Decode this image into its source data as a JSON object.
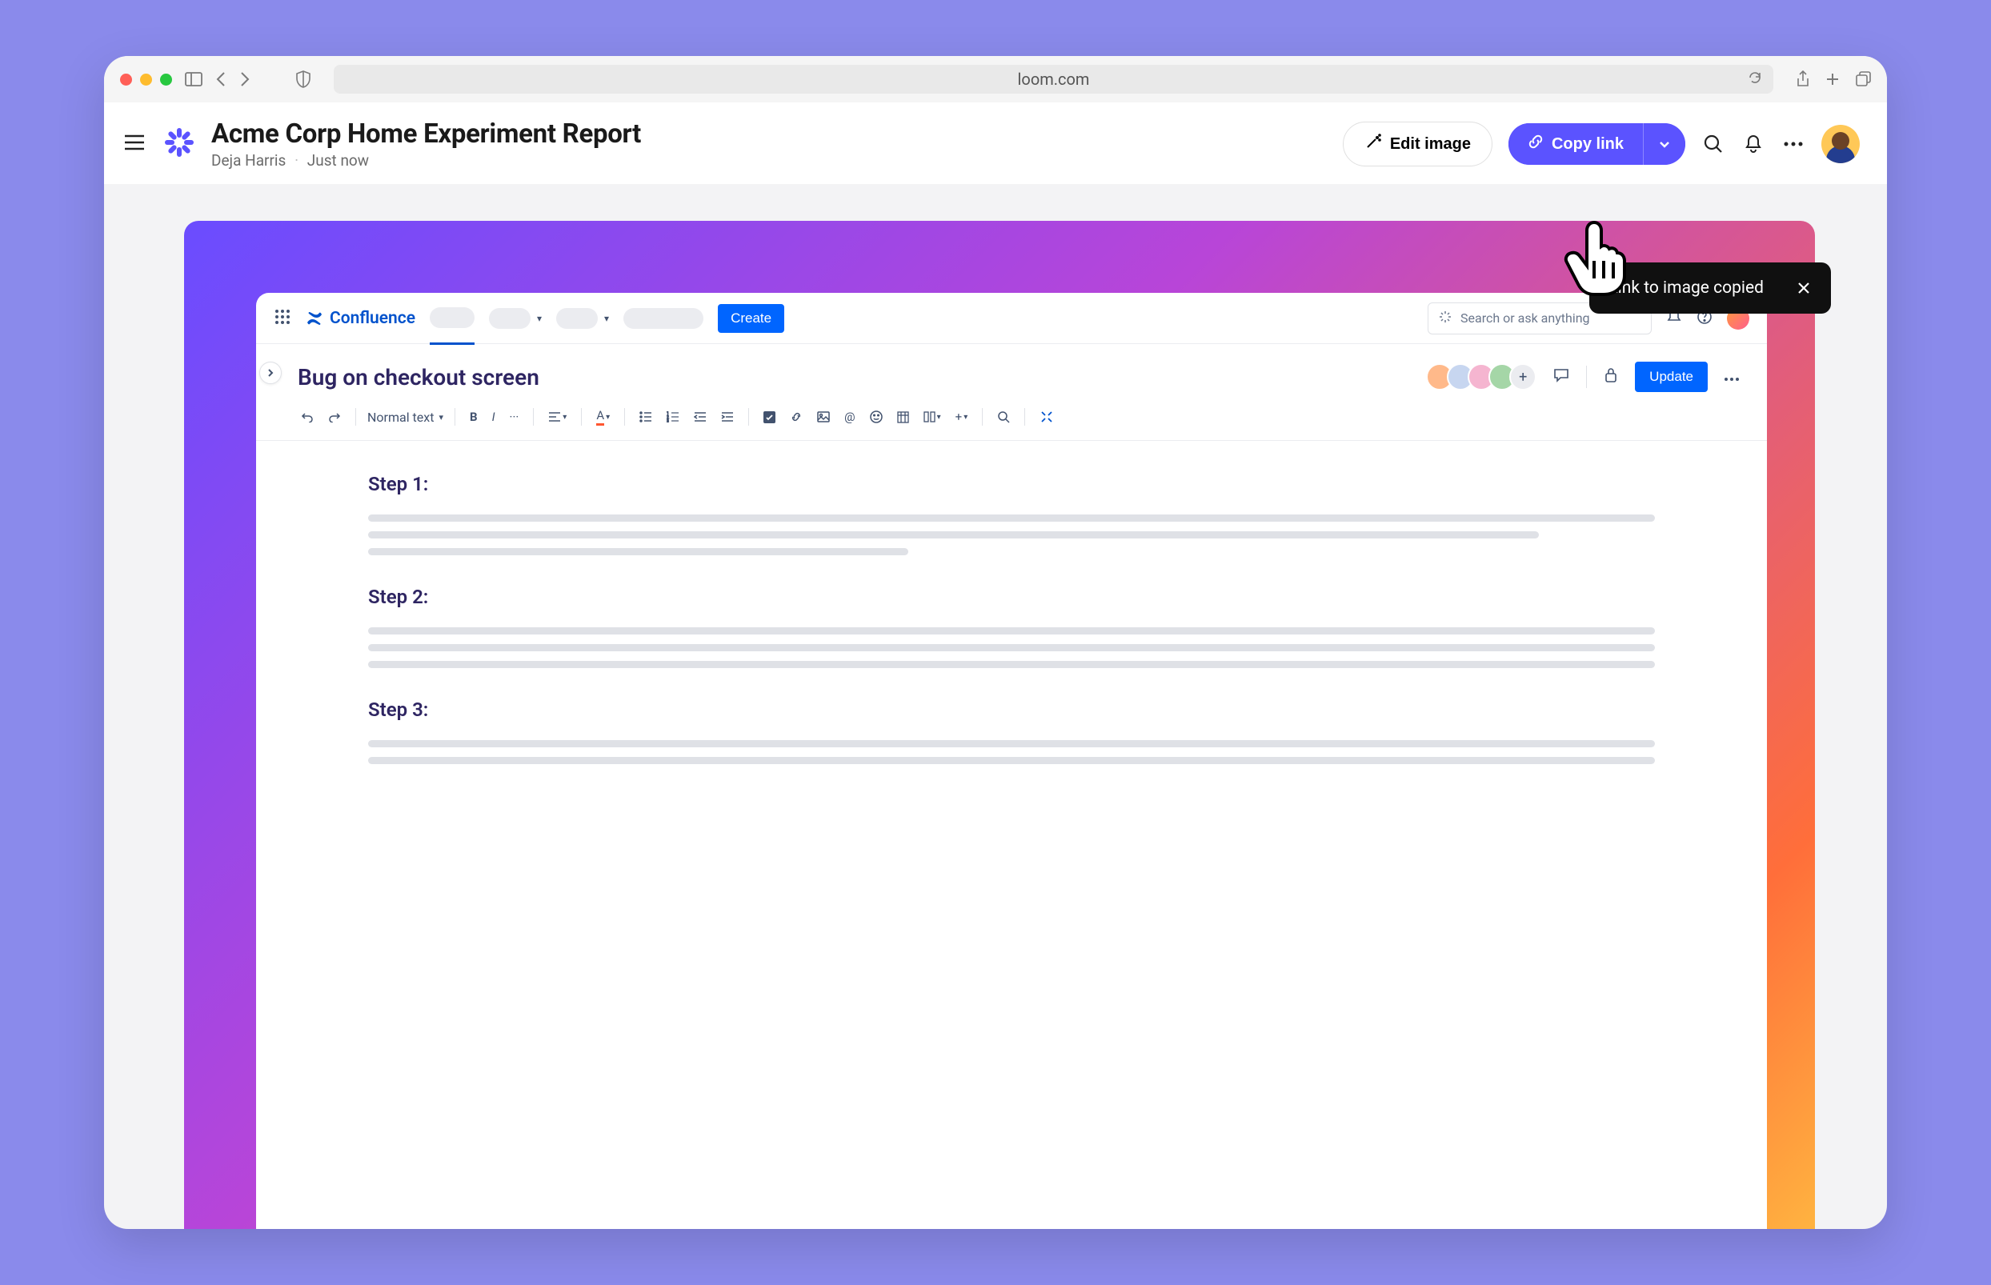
{
  "browser": {
    "url": "loom.com"
  },
  "loom": {
    "title": "Acme Corp Home Experiment Report",
    "author": "Deja Harris",
    "timestamp": "Just now",
    "edit_image_label": "Edit image",
    "copy_link_label": "Copy link"
  },
  "toast": {
    "message": "Link to image copied"
  },
  "confluence": {
    "brand": "Confluence",
    "create_label": "Create",
    "search_placeholder": "Search or ask anything",
    "page_title": "Bug on checkout screen",
    "update_label": "Update",
    "text_style_label": "Normal text",
    "steps": [
      {
        "label": "Step 1:"
      },
      {
        "label": "Step 2:"
      },
      {
        "label": "Step 3:"
      }
    ]
  }
}
